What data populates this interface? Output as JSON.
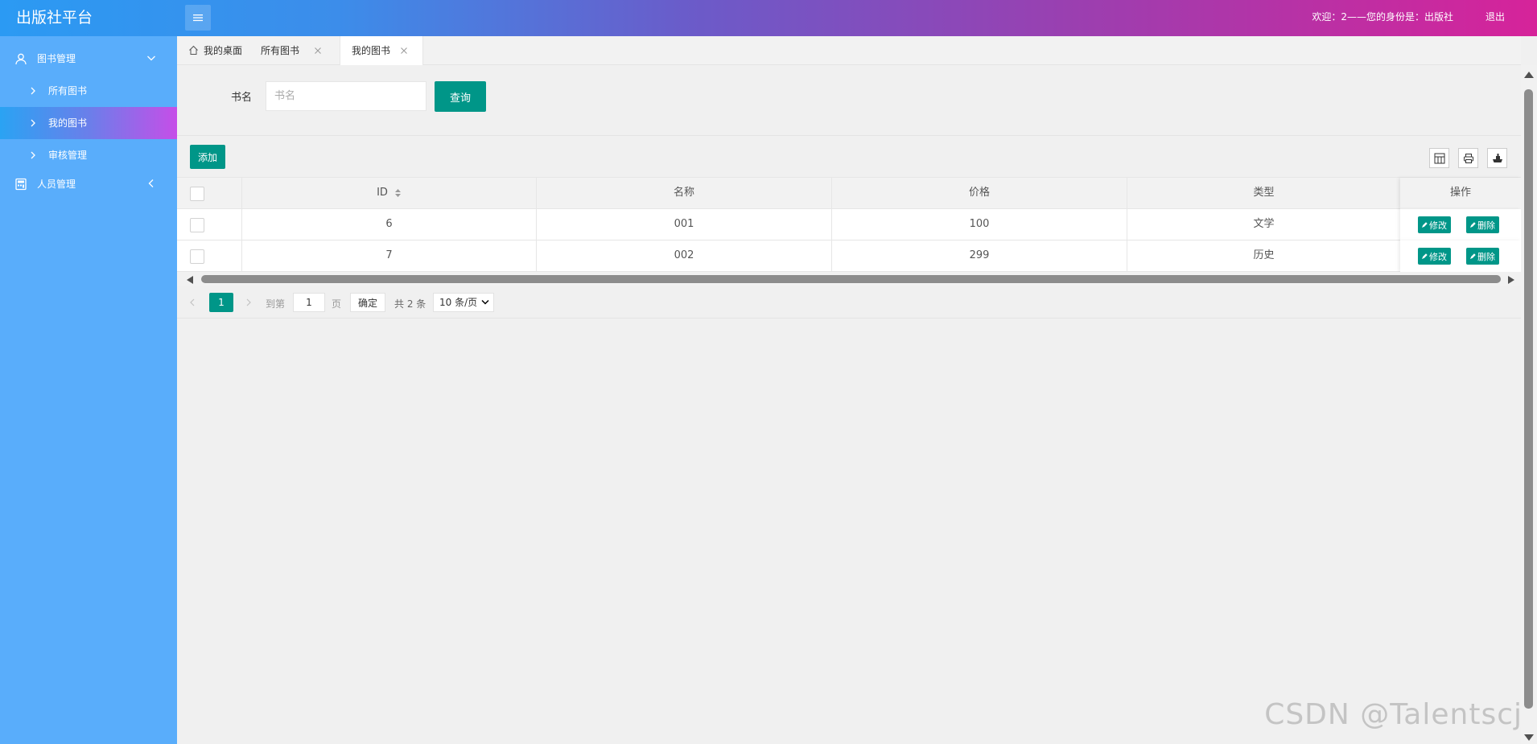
{
  "header": {
    "title": "出版社平台",
    "welcome": "欢迎：2——您的身份是：出版社",
    "logout": "退出"
  },
  "sidebar": {
    "groups": [
      {
        "label": "图书管理",
        "expanded": true,
        "icon": "user-icon",
        "items": [
          {
            "label": "所有图书"
          },
          {
            "label": "我的图书",
            "active": true
          },
          {
            "label": "审核管理"
          }
        ]
      },
      {
        "label": "人员管理",
        "expanded": false,
        "icon": "calculator-icon"
      }
    ]
  },
  "tabs": [
    {
      "label": "我的桌面",
      "icon": "home-icon"
    },
    {
      "label": "所有图书",
      "closable": true
    },
    {
      "label": "我的图书",
      "closable": true,
      "active": true
    }
  ],
  "search": {
    "label": "书名",
    "placeholder": "书名",
    "value": "",
    "button": "查询"
  },
  "toolbar": {
    "add": "添加",
    "icons": [
      "columns-filter-icon",
      "print-icon",
      "export-icon"
    ]
  },
  "table": {
    "columns": [
      "ID",
      "名称",
      "价格",
      "类型",
      "操作"
    ],
    "rows": [
      {
        "id": "6",
        "name": "001",
        "price": "100",
        "type": "文学",
        "edit": "修改",
        "delete": "删除"
      },
      {
        "id": "7",
        "name": "002",
        "price": "299",
        "type": "历史",
        "edit": "修改",
        "delete": "删除"
      }
    ]
  },
  "pager": {
    "current": "1",
    "goto_label": "到第",
    "goto_value": "1",
    "page_suffix": "页",
    "confirm": "确定",
    "total": "共 2 条",
    "page_size": "10 条/页"
  },
  "colors": {
    "primary": "#009688",
    "sidebar": "#59adfb",
    "header_start": "#2b9af3",
    "header_end": "#d6239a"
  },
  "watermark": "CSDN @Talentscj"
}
